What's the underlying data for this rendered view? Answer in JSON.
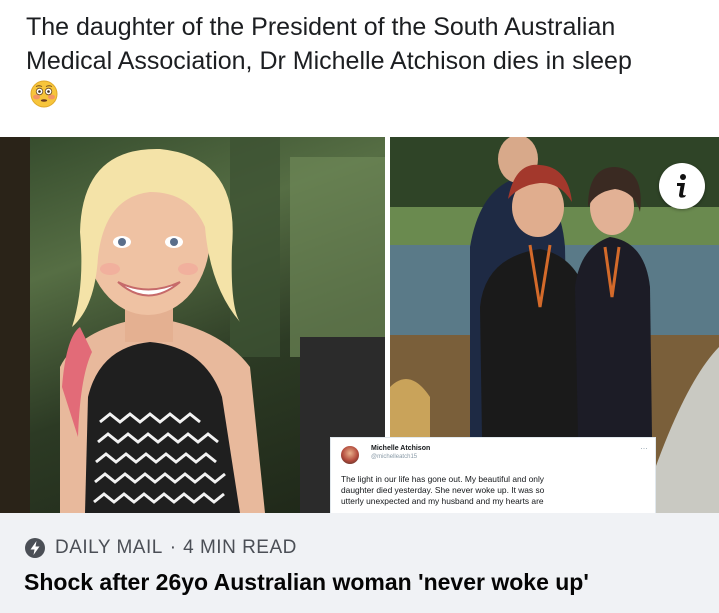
{
  "post": {
    "text": "The daughter of the President of the South Australian Medical Association, Dr Michelle Atchison dies in sleep",
    "emoji": "flushed-face-emoji"
  },
  "media": {
    "info_icon": "info-icon",
    "tweet": {
      "name": "Michelle Atchison",
      "handle": "@michelleatch15",
      "more": "…",
      "lines": [
        "The light in our life has gone out. My beautiful and only",
        "daughter died yesterday. She never woke up. It was so",
        "utterly unexpected and my husband and my hearts are"
      ]
    }
  },
  "link": {
    "source_icon": "lightning-bolt-icon",
    "source": "DAILY MAIL",
    "separator": "·",
    "read_time": "4 MIN READ",
    "title": "Shock after 26yo Australian woman 'never woke up'"
  },
  "colors": {
    "footer_bg": "#f0f2f5",
    "title_text": "#050505",
    "meta_text": "#4b4f56"
  }
}
